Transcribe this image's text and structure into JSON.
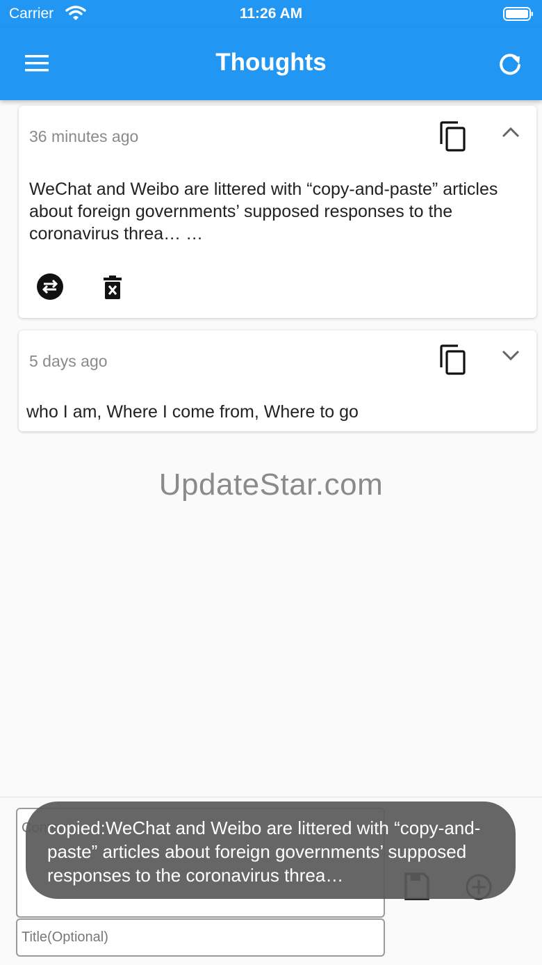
{
  "status_bar": {
    "carrier": "Carrier",
    "time": "11:26 AM"
  },
  "app_bar": {
    "title": "Thoughts"
  },
  "cards": [
    {
      "time": "36 minutes ago",
      "body": "WeChat and Weibo are littered with “copy-and-paste” articles about foreign governments’ supposed responses to the coronavirus threa… …",
      "expanded": true
    },
    {
      "time": "5 days ago",
      "body": "who I am, Where I come from, Where to go",
      "expanded": false
    }
  ],
  "watermark": "UpdateStar.com",
  "compose": {
    "content_placeholder": "Content",
    "title_placeholder": "Title(Optional)"
  },
  "toast": {
    "text": "copied:WeChat and Weibo are littered with “copy-and-paste” articles about foreign governments’ supposed responses to the coronavirus threa…"
  },
  "icons": {
    "menu": "menu-icon",
    "refresh": "refresh-icon",
    "copy": "copy-icon",
    "expand_less": "chevron-up-icon",
    "expand_more": "chevron-down-icon",
    "swap": "swap-icon",
    "delete": "delete-icon",
    "save": "save-icon",
    "add": "add-circle-icon"
  },
  "colors": {
    "primary": "#2196f3",
    "toast": "#5a5a5a",
    "secondary_text": "#8a8a8a"
  }
}
